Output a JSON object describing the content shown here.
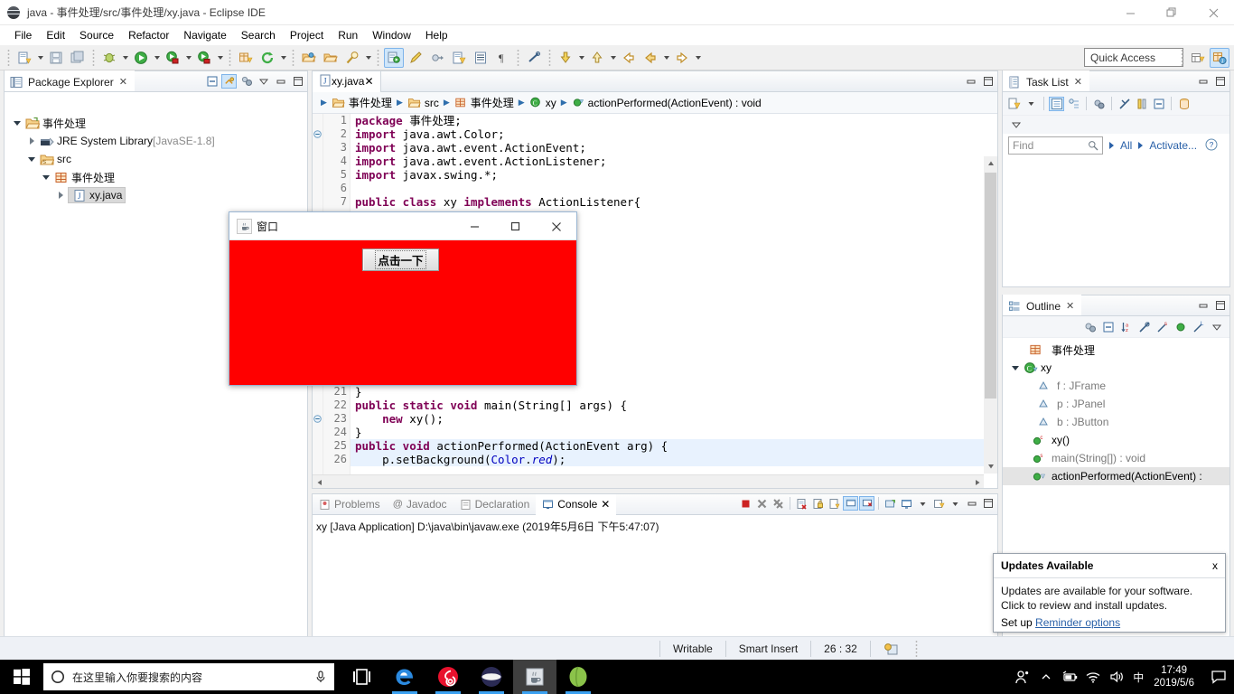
{
  "window": {
    "title": "java - 事件处理/src/事件处理/xy.java - Eclipse IDE",
    "minimize": "–",
    "maximize": "❐",
    "close": "✕"
  },
  "menubar": {
    "items": [
      {
        "label": "File"
      },
      {
        "label": "Edit"
      },
      {
        "label": "Source"
      },
      {
        "label": "Refactor"
      },
      {
        "label": "Navigate"
      },
      {
        "label": "Search"
      },
      {
        "label": "Project"
      },
      {
        "label": "Run"
      },
      {
        "label": "Window"
      },
      {
        "label": "Help"
      }
    ]
  },
  "toolbar": {
    "quick_access": "Quick Access",
    "icons": [
      "new-file-icon",
      "save-icon",
      "save-all-icon",
      "debug-icon",
      "run-icon",
      "run-config-icon",
      "debug-config-icon",
      "new-package-icon",
      "refresh-icon",
      "open-folder-icon",
      "open-type-icon",
      "search-icon",
      "marker-icon",
      "edit-icon",
      "next-annotation-icon",
      "previous-annotation-icon",
      "show-whitespace-icon",
      "pilcrow-icon",
      "link-icon",
      "step-down-icon",
      "step-up-icon",
      "back-icon",
      "forward-icon"
    ]
  },
  "package_explorer": {
    "tab_label": "Package Explorer",
    "tree": [
      {
        "label": "事件处理",
        "indent": 0,
        "twisty": "down",
        "icon": "project-icon",
        "dim": "",
        "selected": false
      },
      {
        "label": "JRE System Library",
        "dim": " [JavaSE-1.8]",
        "indent": 1,
        "twisty": "right",
        "icon": "library-icon",
        "selected": false
      },
      {
        "label": "src",
        "indent": 1,
        "twisty": "down",
        "icon": "source-folder-icon",
        "dim": "",
        "selected": false
      },
      {
        "label": "事件处理",
        "indent": 2,
        "twisty": "down",
        "icon": "package-icon",
        "dim": "",
        "selected": false
      },
      {
        "label": "xy.java",
        "indent": 3,
        "twisty": "right",
        "icon": "java-file-icon",
        "dim": "",
        "selected": true
      }
    ]
  },
  "editor": {
    "tab_label": "xy.java",
    "tab_close": "✕",
    "breadcrumb": [
      {
        "label": "事件处理",
        "icon": "project-icon"
      },
      {
        "label": "src",
        "icon": "source-folder-icon"
      },
      {
        "label": "事件处理",
        "icon": "package-icon"
      },
      {
        "label": "xy",
        "icon": "class-icon"
      },
      {
        "label": "actionPerformed(ActionEvent) : void",
        "icon": "method-icon"
      }
    ],
    "lines": [
      {
        "n": "1",
        "fold": "",
        "html": "<span class='kw'>package</span> 事件处理;",
        "hl": false
      },
      {
        "n": "2",
        "fold": "-",
        "html": "<span class='kw'>import</span> java.awt.Color;",
        "hl": false
      },
      {
        "n": "3",
        "fold": "",
        "html": "<span class='kw'>import</span> java.awt.event.ActionEvent;",
        "hl": false
      },
      {
        "n": "4",
        "fold": "",
        "html": "<span class='kw'>import</span> java.awt.event.ActionListener;",
        "hl": false
      },
      {
        "n": "5",
        "fold": "",
        "html": "<span class='kw'>import</span> javax.swing.*;",
        "hl": false
      },
      {
        "n": "6",
        "fold": "",
        "html": "",
        "hl": false
      },
      {
        "n": "7",
        "fold": "",
        "html": "<span class='kw'>public class</span> xy <span class='kw'>implements</span> ActionListener{",
        "hl": false
      }
    ],
    "lines_lower": [
      {
        "n": "21",
        "fold": "",
        "html": "}",
        "hl": false
      },
      {
        "n": "22",
        "fold": "-",
        "html": "<span class='kw'>public static void</span> main(String[] args) {",
        "hl": false
      },
      {
        "n": "23",
        "fold": "",
        "html": "    <span class='kw'>new</span> xy();",
        "hl": false
      },
      {
        "n": "24",
        "fold": "",
        "html": "}",
        "hl": false
      },
      {
        "n": "25",
        "fold": "-",
        "html": "<span class='kw'>public void</span> actionPerformed(ActionEvent arg) {",
        "hl": true
      },
      {
        "n": "26",
        "fold": "",
        "html": "    p.setBackground(<span class='fld'>Color</span>.<span class='ital'>red</span>);",
        "hl": true
      }
    ]
  },
  "console": {
    "tabs": [
      {
        "label": "Problems",
        "icon": "problems-icon",
        "selected": false
      },
      {
        "label": "Javadoc",
        "icon": "javadoc-icon",
        "selected": false
      },
      {
        "label": "Declaration",
        "icon": "declaration-icon",
        "selected": false
      },
      {
        "label": "Console",
        "icon": "console-icon",
        "selected": true
      }
    ],
    "close_glyph": "✕",
    "output": "xy [Java Application] D:\\java\\bin\\javaw.exe (2019年5月6日 下午5:47:07)"
  },
  "task_list": {
    "tab_label": "Task List",
    "find_placeholder": "Find",
    "all_label": "All",
    "activate_label": "Activate...",
    "help_glyph": "?"
  },
  "outline": {
    "tab_label": "Outline",
    "items": [
      {
        "label": "事件处理",
        "indent": 1,
        "twisty": "",
        "icon": "package-icon",
        "kind": "",
        "type": "",
        "selected": false
      },
      {
        "label": "xy",
        "indent": 0,
        "twisty": "down",
        "icon": "class-icon",
        "kind": "",
        "type": "",
        "selected": false
      },
      {
        "label": "f : JFrame",
        "indent": 2,
        "twisty": "",
        "icon": "field-icon",
        "kind": "",
        "type": "",
        "selected": false
      },
      {
        "label": "p : JPanel",
        "indent": 2,
        "twisty": "",
        "icon": "field-icon",
        "kind": "",
        "type": "",
        "selected": false
      },
      {
        "label": "b : JButton",
        "indent": 2,
        "twisty": "",
        "icon": "field-icon",
        "kind": "",
        "type": "",
        "selected": false
      },
      {
        "label": "xy()",
        "indent": 2,
        "twisty": "",
        "icon": "method-icon",
        "kind": "c",
        "type": "",
        "selected": false
      },
      {
        "label": "main(String[]) : void",
        "indent": 2,
        "twisty": "",
        "icon": "method-icon",
        "kind": "s",
        "type": "",
        "selected": false
      },
      {
        "label": "actionPerformed(ActionEvent) :",
        "indent": 2,
        "twisty": "",
        "icon": "method-icon",
        "kind": "",
        "type": "",
        "selected": true
      }
    ]
  },
  "statusbar": {
    "writable": "Writable",
    "insert_mode": "Smart Insert",
    "position": "26 : 32"
  },
  "swing_window": {
    "title": "窗口",
    "icon": "java-coffee-icon",
    "minimize": "–",
    "maximize": "□",
    "close": "✕",
    "button_label": "点击一下",
    "panel_color": "#ff0000"
  },
  "notification": {
    "title": "Updates Available",
    "close": "x",
    "line1": "Updates are available for your software.",
    "line2": "Click to review and install updates.",
    "setup_prefix": "Set up ",
    "link": "Reminder options"
  },
  "taskbar": {
    "search_placeholder": "在这里输入你要搜索的内容",
    "apps": [
      {
        "name": "task-view-icon"
      },
      {
        "name": "edge-icon"
      },
      {
        "name": "netease-music-icon"
      },
      {
        "name": "browser-icon"
      },
      {
        "name": "eclipse-java-icon"
      },
      {
        "name": "android-studio-icon"
      }
    ],
    "tray": {
      "people_icon": "people-icon",
      "chevron": "^",
      "battery_icon": "battery-icon",
      "wifi_icon": "wifi-icon",
      "volume_icon": "volume-icon",
      "ime": "中",
      "time": "17:49",
      "date": "2019/5/6",
      "action_center": "action-center-icon"
    }
  },
  "colors": {
    "accent": "#2a61a8",
    "red_panel": "#ff0000",
    "selection": "#e8f2fe",
    "taskbar_bg": "#000000"
  }
}
